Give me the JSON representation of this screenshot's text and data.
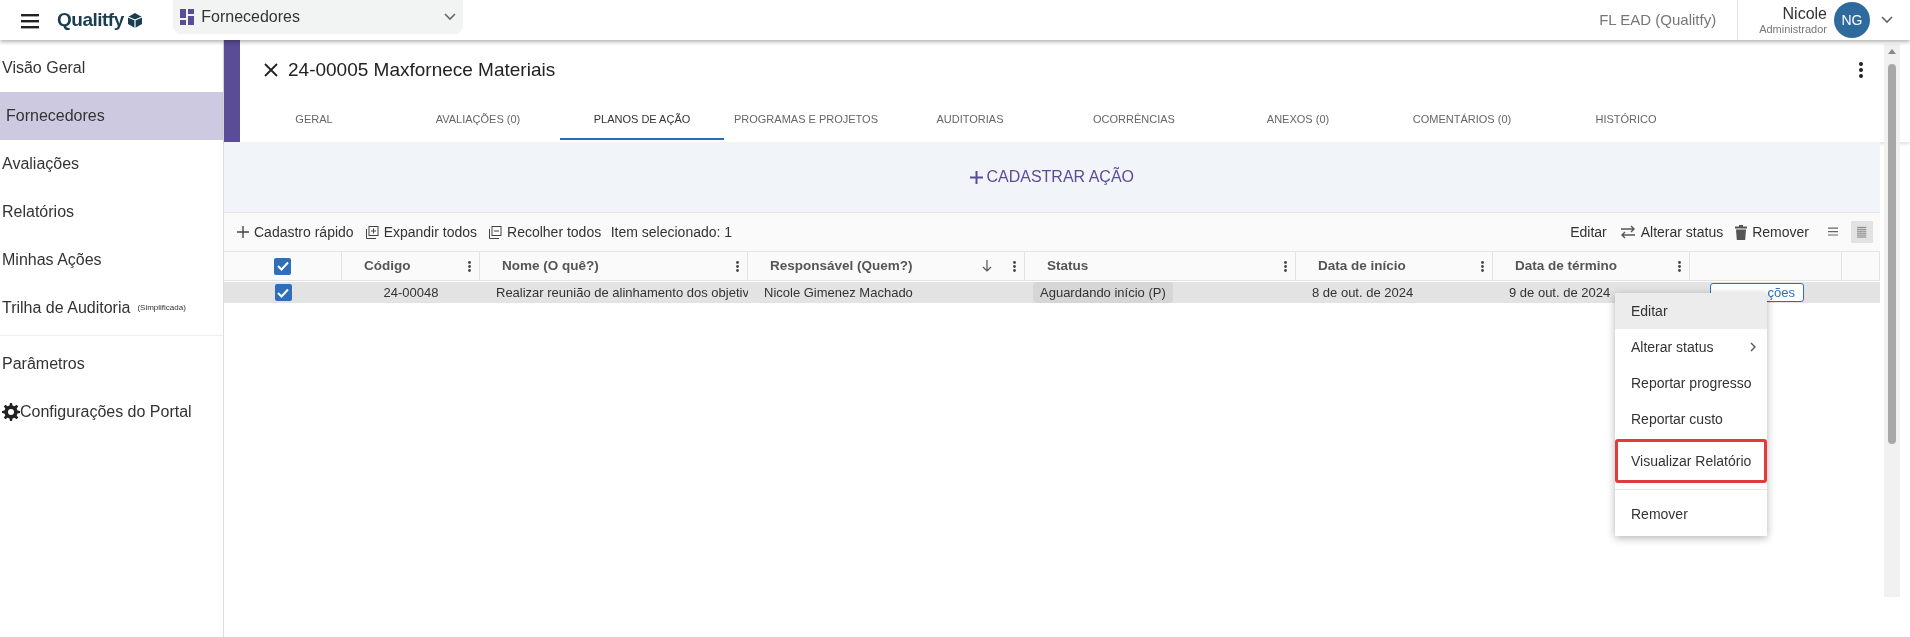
{
  "top_bar": {
    "logo": "Qualitfy",
    "module": "Fornecedores",
    "organization": "FL EAD (Qualitfy)",
    "user": {
      "name": "Nicole",
      "role": "Administrador",
      "initials": "NG"
    }
  },
  "sidebar": {
    "groups": [
      [
        {
          "label": "Visão Geral",
          "selected": false,
          "kind": "plain"
        },
        {
          "label": "Fornecedores",
          "selected": true,
          "kind": "plain"
        },
        {
          "label": "Avaliações",
          "selected": false,
          "kind": "plain"
        },
        {
          "label": "Relatórios",
          "selected": false,
          "kind": "plain"
        },
        {
          "label": "Minhas Ações",
          "selected": false,
          "kind": "plain"
        },
        {
          "label": "Trilha de Auditoria",
          "note": "(Simplificada)",
          "selected": false,
          "kind": "plain"
        }
      ],
      [
        {
          "label": "Parâmetros",
          "selected": false,
          "kind": "plain"
        },
        {
          "label": "Configurações do Portal",
          "selected": false,
          "kind": "gear"
        }
      ]
    ]
  },
  "record": {
    "title": "24-00005 Maxfornece Materiais",
    "tabs": [
      {
        "label": "GERAL",
        "selected": false
      },
      {
        "label": "AVALIAÇÕES (0)",
        "selected": false
      },
      {
        "label": "PLANOS DE AÇÃO",
        "selected": true
      },
      {
        "label": "PROGRAMAS E PROJETOS",
        "selected": false
      },
      {
        "label": "AUDITORIAS",
        "selected": false
      },
      {
        "label": "OCORRÊNCIAS",
        "selected": false
      },
      {
        "label": "ANEXOS (0)",
        "selected": false
      },
      {
        "label": "COMENTÁRIOS (0)",
        "selected": false
      },
      {
        "label": "HISTÓRICO",
        "selected": false
      }
    ]
  },
  "add_action": "CADASTRAR AÇÃO",
  "toolbar": {
    "left": [
      {
        "label": "Cadastro rápido",
        "kind": "add"
      },
      {
        "label": "Expandir todos",
        "kind": "expand"
      },
      {
        "label": "Recolher todos",
        "kind": "collapse"
      }
    ],
    "selection": "Item selecionado: 1",
    "right": [
      {
        "label": "Editar",
        "kind": "text"
      },
      {
        "label": "Alterar status",
        "kind": "swap"
      },
      {
        "label": "Remover",
        "kind": "trash"
      }
    ],
    "view_modes": [
      {
        "kind": "list",
        "selected": false
      },
      {
        "kind": "dense",
        "selected": true
      }
    ]
  },
  "table": {
    "all_checked": true,
    "columns": [
      {
        "label": "Código",
        "sorted_descending": false
      },
      {
        "label": "Nome (O quê?)",
        "sorted_descending": false
      },
      {
        "label": "Responsável (Quem?)",
        "sorted_descending": true
      },
      {
        "label": "Status",
        "sorted_descending": false
      },
      {
        "label": "Data de início",
        "sorted_descending": false
      },
      {
        "label": "Data de término",
        "sorted_descending": false
      }
    ],
    "rows": [
      {
        "checked": true,
        "selected": true,
        "cells": [
          {
            "kind": "text",
            "text": "24-00048"
          },
          {
            "kind": "text",
            "text": "Realizar reunião de alinhamento dos objetiv"
          },
          {
            "kind": "text",
            "text": "Nicole Gimenez Machado"
          },
          {
            "kind": "tag",
            "text": "Aguardando início (P)"
          },
          {
            "kind": "text",
            "text": "8 de out. de 2024"
          },
          {
            "kind": "text",
            "text": "9 de out. de 2024"
          }
        ],
        "action": "ções"
      }
    ]
  },
  "context_menu": {
    "groups": [
      [
        {
          "label": "Editar",
          "hovered": true,
          "submenu": false,
          "highlighted": false
        },
        {
          "label": "Alterar status",
          "hovered": false,
          "submenu": true,
          "highlighted": false
        },
        {
          "label": "Reportar progresso",
          "hovered": false,
          "submenu": false,
          "highlighted": false
        },
        {
          "label": "Reportar custo",
          "hovered": false,
          "submenu": false,
          "highlighted": false
        },
        {
          "label": "Visualizar Relatório",
          "hovered": false,
          "submenu": false,
          "highlighted": true
        }
      ],
      [
        {
          "label": "Remover",
          "hovered": false,
          "submenu": false,
          "highlighted": false
        }
      ]
    ]
  }
}
